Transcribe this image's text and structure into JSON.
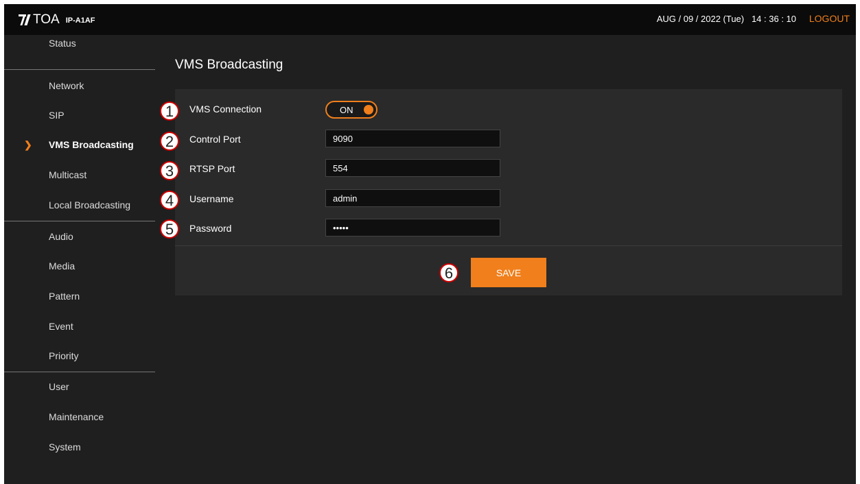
{
  "header": {
    "brand": "TOA",
    "model": "IP-A1AF",
    "datetime": "AUG / 09 / 2022 (Tue)   14 : 36 : 10",
    "logout_label": "LOGOUT"
  },
  "sidebar": {
    "items": [
      {
        "label": "Status"
      },
      {
        "label": "Network"
      },
      {
        "label": "SIP"
      },
      {
        "label": "VMS Broadcasting",
        "active": true
      },
      {
        "label": "Multicast"
      },
      {
        "label": "Local Broadcasting"
      },
      {
        "label": "Audio"
      },
      {
        "label": "Media"
      },
      {
        "label": "Pattern"
      },
      {
        "label": "Event"
      },
      {
        "label": "Priority"
      },
      {
        "label": "User"
      },
      {
        "label": "Maintenance"
      },
      {
        "label": "System"
      }
    ]
  },
  "main": {
    "title": "VMS Broadcasting",
    "vms_connection": {
      "label": "VMS Connection",
      "toggle_text": "ON"
    },
    "control_port": {
      "label": "Control Port",
      "value": "9090"
    },
    "rtsp_port": {
      "label": "RTSP Port",
      "value": "554"
    },
    "username": {
      "label": "Username",
      "value": "admin"
    },
    "password": {
      "label": "Password",
      "value": "•••••"
    },
    "save_label": "SAVE"
  },
  "callouts": [
    "1",
    "2",
    "3",
    "4",
    "5",
    "6"
  ],
  "colors": {
    "accent": "#f07f1c",
    "background": "#1f1f1f",
    "panel": "#2a2a2a",
    "topbar": "#0b0b0b"
  }
}
